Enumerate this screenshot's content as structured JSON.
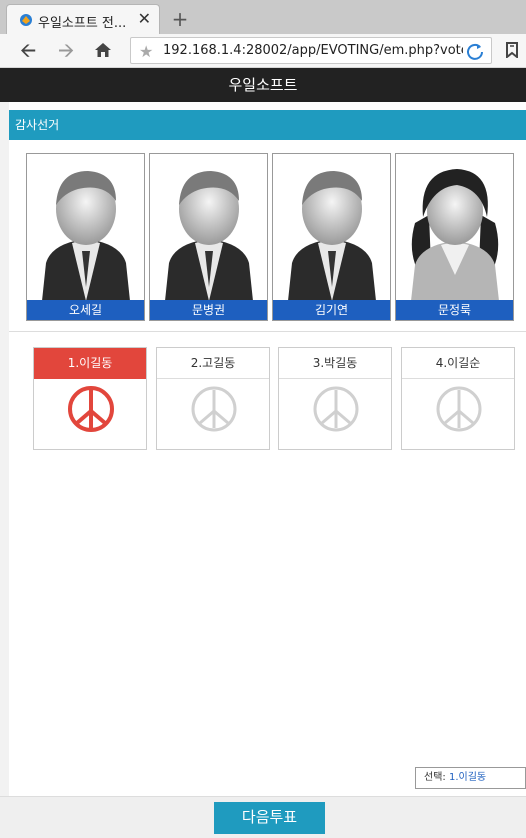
{
  "browser": {
    "tab_title": "우일소프트 전...",
    "tab_close": "✕",
    "new_tab": "+",
    "url": "192.168.1.4:28002/app/EVOTING/em.php?vote_st",
    "icons": [
      "back-icon",
      "forward-icon",
      "home-icon",
      "star-icon",
      "reload-icon",
      "bookmark-icon"
    ]
  },
  "header": {
    "title": "우일소프트"
  },
  "section": {
    "title": "감사선거"
  },
  "candidates": [
    {
      "name": "오세길",
      "gender": "male"
    },
    {
      "name": "문병권",
      "gender": "male"
    },
    {
      "name": "김기연",
      "gender": "male"
    },
    {
      "name": "문정룩",
      "gender": "female"
    }
  ],
  "choices": [
    {
      "label": "1.이길동",
      "selected": true
    },
    {
      "label": "2.고길동",
      "selected": false
    },
    {
      "label": "3.박길동",
      "selected": false
    },
    {
      "label": "4.이길순",
      "selected": false
    }
  ],
  "selection": {
    "label": "선택:",
    "value": "1.이길동"
  },
  "footer": {
    "next_label": "다음투표"
  },
  "colors": {
    "accent": "#1f9bbf",
    "name_bar": "#1e5fbf",
    "selected": "#e2463c",
    "header": "#222222"
  }
}
